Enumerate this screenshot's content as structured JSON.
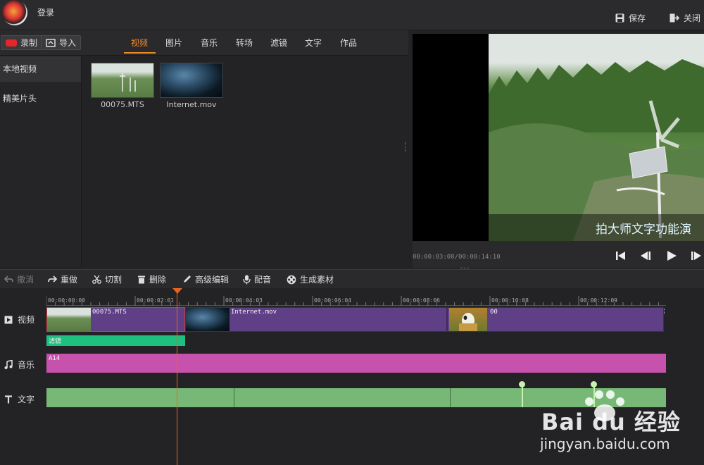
{
  "header": {
    "login": "登录",
    "save": "保存",
    "close": "关闭"
  },
  "library": {
    "record": "录制",
    "import": "导入",
    "tabs": [
      "视频",
      "图片",
      "音乐",
      "转场",
      "滤镜",
      "文字",
      "作品"
    ],
    "active_tab": "视频",
    "sidebar": [
      "本地视频",
      "精美片头"
    ],
    "media": [
      {
        "name": "00075.MTS"
      },
      {
        "name": "Internet.mov"
      }
    ]
  },
  "preview": {
    "subtitle": "拍大师文字功能演",
    "timecode": "00:00:03:00/00:00:14:10"
  },
  "toolbar": {
    "undo": "撤消",
    "redo": "重做",
    "cut": "切割",
    "delete": "删除",
    "advanced_edit": "高级编辑",
    "dub": "配音",
    "generate": "生成素材"
  },
  "timeline": {
    "ticks": [
      "00:00:00:00",
      "00:00:02:01",
      "00:00:04:03",
      "00:00:06:04",
      "00:00:08:06",
      "00:00:10:08",
      "00:00:12:09"
    ],
    "tracks": {
      "video": "视频",
      "music": "音乐",
      "text": "文字"
    },
    "video_clips": [
      "00075.MTS",
      "Internet.mov",
      "00"
    ],
    "filter_label": "滤镜",
    "music_clip": "A14"
  },
  "watermark": {
    "brand": "Bai du 经验",
    "url": "jingyan.baidu.com"
  },
  "colors": {
    "accent": "#f0882a",
    "playhead": "#e8641e",
    "video_clip": "#5f3f86",
    "filter": "#1fbf7f",
    "music": "#c652ae",
    "text_track": "#77b877"
  }
}
